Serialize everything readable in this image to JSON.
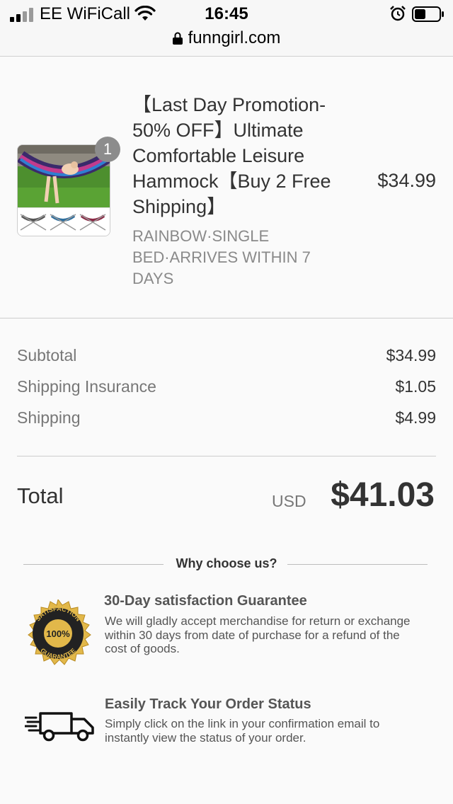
{
  "status_bar": {
    "carrier": "EE WiFiCall",
    "time": "16:45",
    "url": "funngirl.com"
  },
  "product": {
    "quantity": "1",
    "title": "【Last Day Promotion-50% OFF】Ultimate Comfortable Leisure Hammock【Buy 2 Free Shipping】",
    "variant": "RAINBOW·SINGLE BED·ARRIVES WITHIN 7 DAYS",
    "price": "$34.99"
  },
  "summary": {
    "subtotal_label": "Subtotal",
    "subtotal_value": "$34.99",
    "insurance_label": "Shipping Insurance",
    "insurance_value": "$1.05",
    "shipping_label": "Shipping",
    "shipping_value": "$4.99",
    "total_label": "Total",
    "total_currency": "USD",
    "total_value": "$41.03"
  },
  "why_choose": {
    "heading": "Why choose us?",
    "guarantee": {
      "badge_top": "SATISFACTION",
      "badge_center": "100%",
      "badge_bottom": "GUARANTEE",
      "title": "30-Day satisfaction Guarantee",
      "description": "We will gladly accept merchandise for return or exchange within 30 days from date of purchase for a refund of the cost of goods."
    },
    "tracking": {
      "title": "Easily Track Your Order Status",
      "description": "Simply click on the link in your confirmation email to instantly view the status of your order."
    }
  },
  "icons": {
    "signal": "signal-bars-icon",
    "wifi": "wifi-icon",
    "alarm": "alarm-clock-icon",
    "battery": "battery-icon",
    "lock": "lock-icon",
    "guarantee": "gold-seal-icon",
    "truck": "delivery-truck-icon"
  },
  "colors": {
    "background": "#fafafa",
    "badge": "#8c8c8c",
    "seal_gold": "#e2b84a",
    "seal_dark": "#222222"
  }
}
